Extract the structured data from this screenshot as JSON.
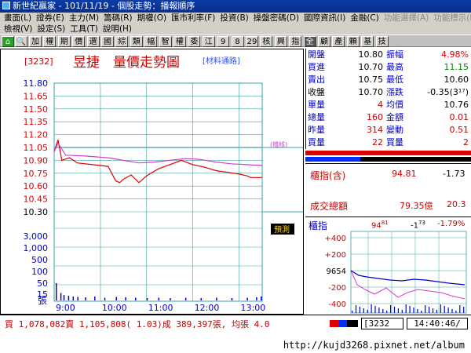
{
  "window": {
    "title": "新世紀贏家 - 101/11/19 - 個股走勢：播報順序"
  },
  "menu": {
    "row1": [
      "畫面(L)",
      "證券(E)",
      "主力(M)",
      "籌碼(R)",
      "期權(O)",
      "匯市利率(F)",
      "投資(B)",
      "操盤密碼(D)",
      "國際資訊(I)",
      "金融(C)",
      "功能選擇(A)",
      "功能標示(E)"
    ],
    "row2": [
      "檢視(V)",
      "設定(S)",
      "工具(T)",
      "說明(H)"
    ]
  },
  "toolbar": {
    "buttons": [
      "加",
      "權",
      "期",
      "價",
      "選",
      "國",
      "綜",
      "類",
      "幅",
      "智",
      "權",
      "委",
      "江",
      "9",
      "8",
      "29",
      "核",
      "興",
      "指",
      "全",
      "顧",
      "產",
      "顆",
      "基",
      "技"
    ]
  },
  "chart": {
    "stock_code": "[3232]",
    "stock_name": "昱捷",
    "chart_title": "量價走勢圖",
    "material_tag": "[材料通路]",
    "ref_tag": "(稽核)",
    "tag_box": "預測",
    "vol_unit": "張"
  },
  "chart_data": {
    "type": "line",
    "title": "量價走勢圖",
    "x": [
      "9:00",
      "10:00",
      "11:00",
      "12:00",
      "13:00"
    ],
    "price_ticks": [
      11.8,
      11.65,
      11.5,
      11.35,
      11.2,
      11.05,
      10.9,
      10.75,
      10.6,
      10.45,
      10.3
    ],
    "volume_ticks": [
      "3,000",
      "1,000",
      "500",
      "100",
      "50",
      "15"
    ],
    "ylim": [
      10.3,
      11.8
    ],
    "reference_price": 11.05,
    "series": [
      {
        "color": "#e00000",
        "points": [
          [
            0,
            11.0
          ],
          [
            5,
            11.14
          ],
          [
            10,
            10.9
          ],
          [
            20,
            10.93
          ],
          [
            30,
            10.87
          ],
          [
            50,
            10.85
          ],
          [
            70,
            10.83
          ],
          [
            80,
            10.66
          ],
          [
            85,
            10.64
          ],
          [
            90,
            10.68
          ],
          [
            100,
            10.73
          ],
          [
            110,
            10.64
          ],
          [
            120,
            10.72
          ],
          [
            135,
            10.8
          ],
          [
            150,
            10.85
          ],
          [
            165,
            10.9
          ],
          [
            180,
            10.85
          ],
          [
            195,
            10.82
          ],
          [
            210,
            10.78
          ],
          [
            225,
            10.76
          ],
          [
            240,
            10.74
          ],
          [
            250,
            10.72
          ],
          [
            255,
            10.7
          ],
          [
            270,
            10.7
          ]
        ]
      },
      {
        "color": "#d040d0",
        "points": [
          [
            0,
            11.0
          ],
          [
            5,
            11.1
          ],
          [
            15,
            10.96
          ],
          [
            40,
            10.95
          ],
          [
            70,
            10.93
          ],
          [
            90,
            10.9
          ],
          [
            110,
            10.87
          ],
          [
            130,
            10.88
          ],
          [
            150,
            10.9
          ],
          [
            170,
            10.92
          ],
          [
            190,
            10.91
          ],
          [
            210,
            10.88
          ],
          [
            230,
            10.86
          ],
          [
            250,
            10.85
          ],
          [
            270,
            10.84
          ]
        ]
      }
    ],
    "volume_bars": [
      [
        2,
        40
      ],
      [
        8,
        15
      ],
      [
        12,
        10
      ],
      [
        18,
        8
      ],
      [
        24,
        6
      ],
      [
        30,
        5
      ],
      [
        40,
        4
      ],
      [
        52,
        6
      ],
      [
        65,
        3
      ],
      [
        80,
        5
      ],
      [
        92,
        4
      ],
      [
        105,
        3
      ],
      [
        120,
        2
      ],
      [
        135,
        3
      ],
      [
        150,
        2
      ],
      [
        170,
        3
      ],
      [
        190,
        2
      ],
      [
        210,
        3
      ],
      [
        230,
        2
      ],
      [
        250,
        3
      ],
      [
        262,
        4
      ],
      [
        268,
        6
      ]
    ]
  },
  "quote": {
    "rows": [
      {
        "l1": "開盤",
        "v1": "10.80",
        "l2": "振幅",
        "v2": "4.98%",
        "c1": "#0000cc",
        "cv1": "#000000",
        "c2": "#0000cc",
        "cv2": "#e00000"
      },
      {
        "l1": "買進",
        "v1": "10.70",
        "l2": "最高",
        "v2": "11.15",
        "c1": "#0000cc",
        "cv1": "#000000",
        "c2": "#0000cc",
        "cv2": "#008000"
      },
      {
        "l1": "賣出",
        "v1": "10.75",
        "l2": "最低",
        "v2": "10.60",
        "c1": "#0000cc",
        "cv1": "#000000",
        "c2": "#0000cc",
        "cv2": "#000000"
      },
      {
        "l1": "收盤",
        "v1": "10.70",
        "l2": "漲跌",
        "v2": "-0.35(3¹⁷)",
        "c1": "#000000",
        "cv1": "#000000",
        "c2": "#0000cc",
        "cv2": "#000000"
      },
      {
        "l1": "單量",
        "v1": "4",
        "l2": "均價",
        "v2": "10.76",
        "c1": "#0000cc",
        "cv1": "#cc0000",
        "c2": "#0000cc",
        "cv2": "#000000"
      },
      {
        "l1": "總量",
        "v1": "160",
        "l2": "金額",
        "v2": "0.01",
        "c1": "#0000cc",
        "cv1": "#cc0000",
        "c2": "#0000cc",
        "cv2": "#cc0000"
      },
      {
        "l1": "昨量",
        "v1": "314",
        "l2": "變動",
        "v2": "0.51",
        "c1": "#0000cc",
        "cv1": "#cc0000",
        "c2": "#0000cc",
        "cv2": "#cc0000"
      },
      {
        "l1": "買量",
        "v1": "22",
        "l2": "買量",
        "v2": "2",
        "c1": "#0000cc",
        "cv1": "#cc0000",
        "c2": "#0000cc",
        "cv2": "#cc0000"
      }
    ]
  },
  "index": {
    "label": "櫃指(含)",
    "value": "94.81",
    "change": "-1.73",
    "turnover_label": "成交總額",
    "turnover_value": "79.35億",
    "turnover_extra": "20.3"
  },
  "mini": {
    "label": "櫃指",
    "value": "94",
    "value_sup": "81",
    "change": "-1",
    "change_sup": "73",
    "pct": "-1.79%",
    "ticks": [
      "+400",
      "+200",
      "9654",
      "-200",
      "-400"
    ]
  },
  "status": {
    "text": "買 1,078,082賣 1,105,808( 1.03)成 389,397張, 均張 4.0",
    "code": "[3232",
    "time": "14:40:46/"
  },
  "footer": {
    "url": "http://kujd3268.pixnet.net/album"
  }
}
